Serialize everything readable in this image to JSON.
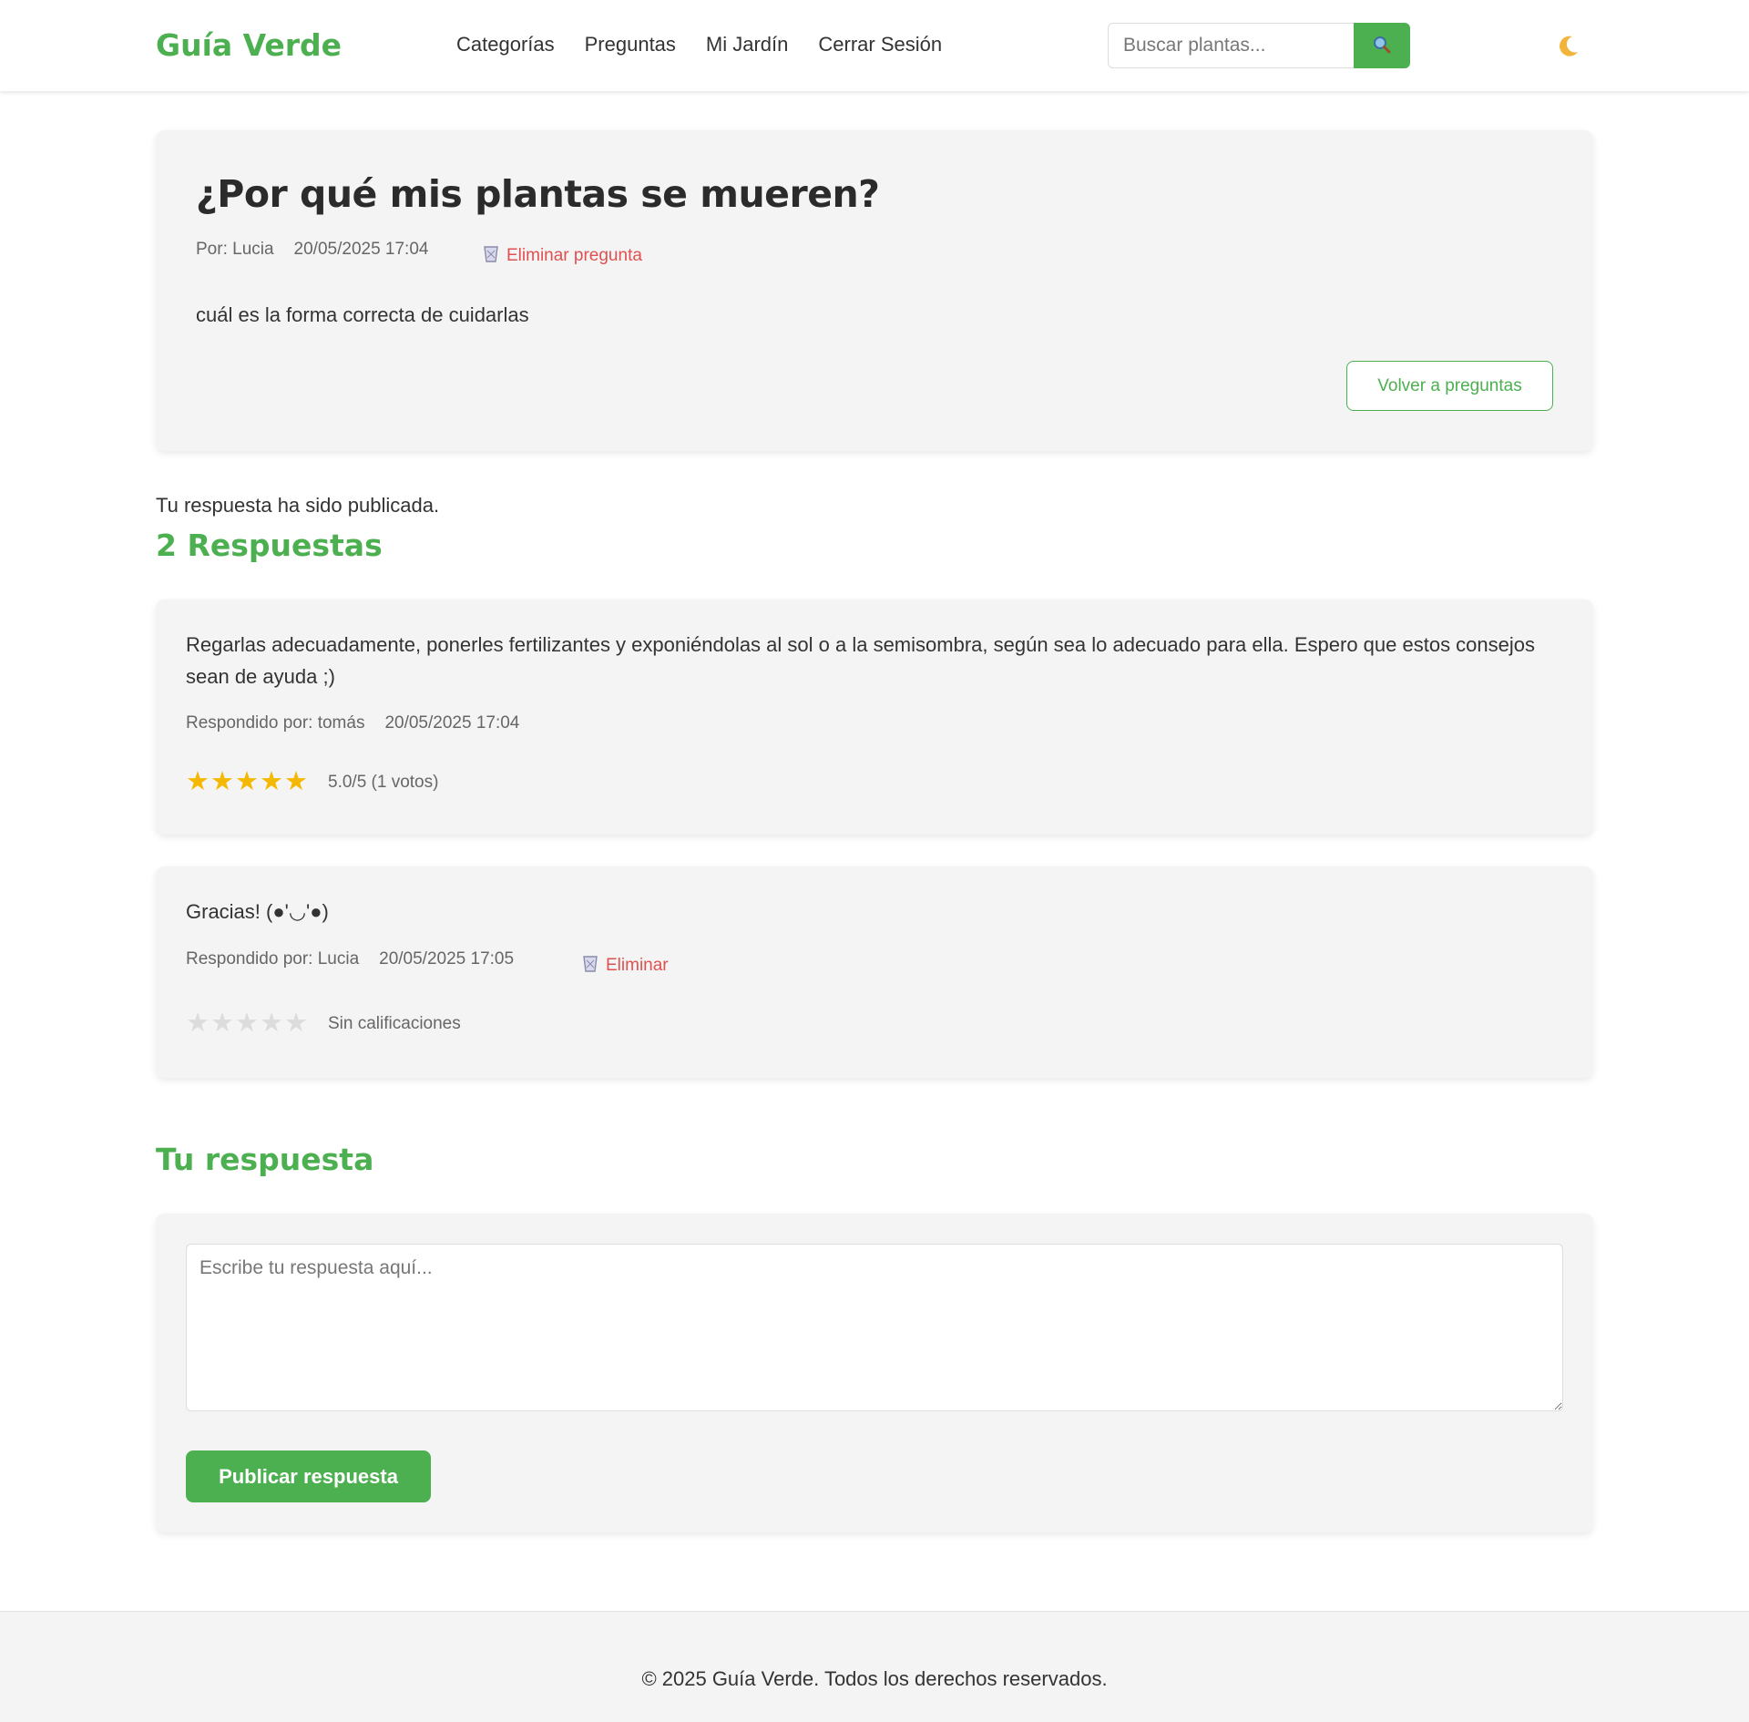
{
  "header": {
    "logo": "Guía Verde",
    "nav": [
      "Categorías",
      "Preguntas",
      "Mi Jardín",
      "Cerrar Sesión"
    ],
    "search_placeholder": "Buscar plantas...",
    "search_icon": "magnifier-icon",
    "theme_icon": "moon-icon"
  },
  "question": {
    "title": "¿Por qué mis plantas se mueren?",
    "author": "Por: Lucia",
    "date": "20/05/2025 17:04",
    "delete_label": "Eliminar pregunta",
    "delete_icon": "trash-icon",
    "body": "cuál es la forma correcta de cuidarlas",
    "back_label": "Volver a preguntas"
  },
  "flash_message": "Tu respuesta ha sido publicada.",
  "answers_heading": "2 Respuestas",
  "answers": [
    {
      "body": "Regarlas adecuadamente, ponerles fertilizantes y exponiéndolas al sol o a la semisombra, según sea lo adecuado para ella. Espero que estos consejos sean de ayuda ;)",
      "author": "Respondido por: tomás",
      "date": "20/05/2025 17:04",
      "rating": 5,
      "rating_text": "5.0/5 (1 votos)"
    },
    {
      "body": "Gracias! (●'◡'●)",
      "author": "Respondido por: Lucia",
      "date": "20/05/2025 17:05",
      "delete_label": "Eliminar",
      "rating": 0,
      "rating_text": "Sin calificaciones"
    }
  ],
  "form": {
    "heading": "Tu respuesta",
    "placeholder": "Escribe tu respuesta aquí...",
    "submit_label": "Publicar respuesta"
  },
  "footer": {
    "text": "© 2025 Guía Verde. Todos los derechos reservados."
  },
  "colors": {
    "accent": "#4caf50",
    "danger": "#e05050",
    "star_on": "#f5b800",
    "star_off": "#dcdcdc",
    "card_bg": "#f4f4f4"
  }
}
